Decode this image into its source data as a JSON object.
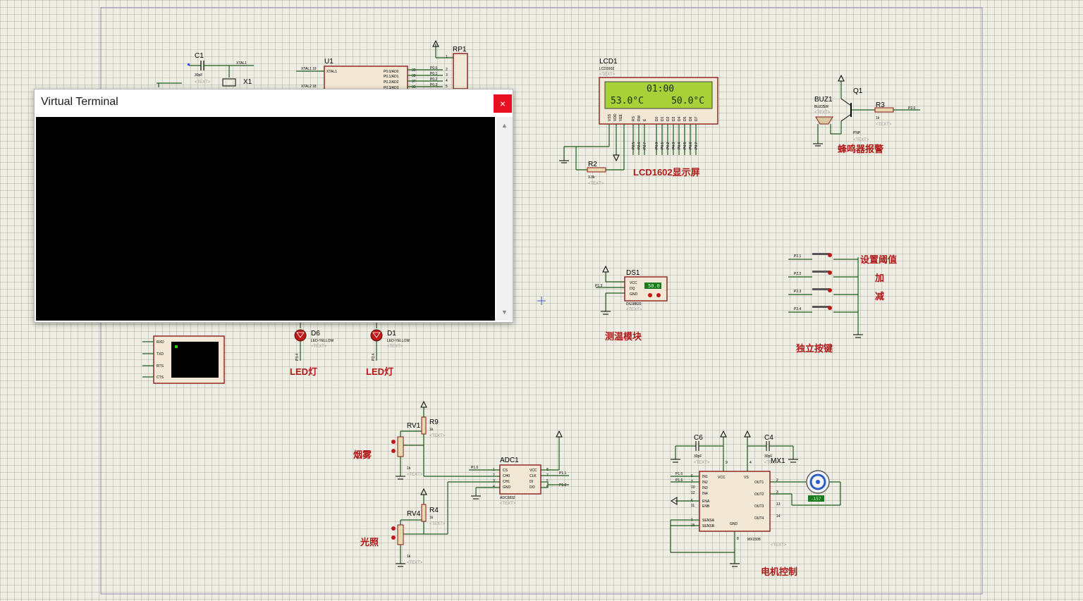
{
  "window": {
    "title": "Virtual Terminal",
    "close_glyph": "×",
    "scroll_up_glyph": "▲",
    "scroll_down_glyph": "▼"
  },
  "colors": {
    "grid_bg": "#eeeee4",
    "component_outline": "#8b1a1a",
    "wire": "#1e5a1e",
    "annotation": "#b01818",
    "lcd_screen": "#9acd32"
  },
  "components": {
    "c1": {
      "ref": "C1",
      "value": "30pF",
      "text": "<TEXT>",
      "net": "XTAL1"
    },
    "x1": {
      "ref": "X1",
      "value": "11.0592M"
    },
    "u1": {
      "ref": "U1",
      "pin_xtal1": "XTAL1",
      "net_xtal1": "XTAL1",
      "net_xtal2": "XTAL2",
      "pins": [
        "P0.0/AD0",
        "P0.1/AD1",
        "P0.2/AD2",
        "P0.3/AD3"
      ],
      "pin_nums": [
        "39",
        "38",
        "37",
        "36"
      ],
      "xtal_pin": "19",
      "xtal2_pin": "18"
    },
    "rp1": {
      "ref": "RP1",
      "pins": [
        "P0.0",
        "P0.1",
        "P0.2",
        "P0.3"
      ],
      "nums": [
        "1",
        "2",
        "3",
        "4",
        "5"
      ]
    },
    "lcd1": {
      "ref": "LCD1",
      "type": "LCD1602",
      "text": "<TEXT>",
      "line1": "01:00",
      "line2": "53.0°C     50.0°C",
      "pins": [
        "VSS",
        "VDD",
        "VEE",
        "RS",
        "RW",
        "E",
        "D0",
        "D1",
        "D2",
        "D3",
        "D4",
        "D5",
        "D6",
        "D7"
      ],
      "nets": [
        "P2.5",
        "P2.6",
        "P2.7",
        "P0.0",
        "P0.1",
        "P0.2",
        "P0.3",
        "P0.4",
        "P0.5",
        "P0.6",
        "P0.7"
      ]
    },
    "r2": {
      "ref": "R2",
      "value": "3.3k",
      "text": "<TEXT>"
    },
    "buz1": {
      "ref": "BUZ1",
      "type": "BUZZER",
      "text": "<TEXT>"
    },
    "q1": {
      "ref": "Q1",
      "type": "PNP",
      "text": "<TEXT>"
    },
    "r3": {
      "ref": "R3",
      "value": "1k",
      "text": "<TEXT>",
      "net": "P2.0"
    },
    "ds1": {
      "ref": "DS1",
      "type": "DS18B20",
      "text": "<TEXT>",
      "pins": [
        "VCC",
        "DQ",
        "GND"
      ],
      "net": "P1.3",
      "reading": "50.0"
    },
    "keys": {
      "nets": [
        "P2.1",
        "P2.2",
        "P2.3",
        "P2.4"
      ]
    },
    "d6": {
      "ref": "D6",
      "type": "LED-YELLOW",
      "text": "<TEXT>",
      "net": "P3.4"
    },
    "d1": {
      "ref": "D1",
      "type": "LED-YELLOW",
      "text": "<TEXT>",
      "net": "P3.4"
    },
    "vterm": {
      "pins": [
        "RXD",
        "TXD",
        "RTS",
        "CTS"
      ]
    },
    "rv1": {
      "ref": "RV1",
      "value": "1k",
      "text": "<TEXT>"
    },
    "r9": {
      "ref": "R9",
      "value": "1k",
      "text": "<TEXT>"
    },
    "rv4": {
      "ref": "RV4",
      "value": "1k",
      "text": "<TEXT>"
    },
    "r4": {
      "ref": "R4",
      "value": "1k",
      "text": "<TEXT>"
    },
    "adc1": {
      "ref": "ADC1",
      "type": "ADC0832",
      "text": "<TEXT>",
      "left_pins": [
        "CS",
        "CH0",
        "CH1",
        "GND"
      ],
      "right_pins": [
        "VCC",
        "CLK",
        "DI",
        "DO"
      ],
      "left_nums": [
        "1",
        "2",
        "3",
        "4"
      ],
      "right_nums": [
        "8",
        "7",
        "5",
        "6"
      ],
      "nets": [
        "P1.0",
        "P1.1",
        "P1.2"
      ]
    },
    "c6": {
      "ref": "C6",
      "value": "30pF",
      "text": "<TEXT>"
    },
    "c4": {
      "ref": "C4",
      "value": "30pF",
      "text": "<TEXT>"
    },
    "mx1": {
      "ref": "MX1",
      "type": "MX1508",
      "text": "<TEXT>",
      "left_pins": [
        "IN1",
        "IN2",
        "IN3",
        "IN4",
        "ENA",
        "ENB",
        "SENSA",
        "SENSB"
      ],
      "left_nums": [
        "6",
        "7",
        "10",
        "12",
        "6",
        "11",
        "1",
        "15"
      ],
      "right_pins": [
        "OUT1",
        "OUT2",
        "OUT3",
        "OUT4"
      ],
      "right_nums": [
        "2",
        "3",
        "13",
        "14"
      ],
      "top_pins": [
        "VCC",
        "VS"
      ],
      "top_nums": [
        "9",
        "4"
      ],
      "gnd": "GND",
      "gnd_num": "8",
      "nets": [
        "P1.5",
        "P1.6"
      ]
    },
    "motor": {
      "reading": "-157"
    }
  },
  "annotations": {
    "lcd": "LCD1602显示屏",
    "buzzer": "蜂鸣器报警",
    "temp": "测温模块",
    "keys_title": "独立按键",
    "key1": "设置阈值",
    "key2": "加",
    "key3": "减",
    "led1": "LED灯",
    "led2": "LED灯",
    "smoke": "烟雾",
    "light": "光照",
    "motor": "电机控制"
  }
}
